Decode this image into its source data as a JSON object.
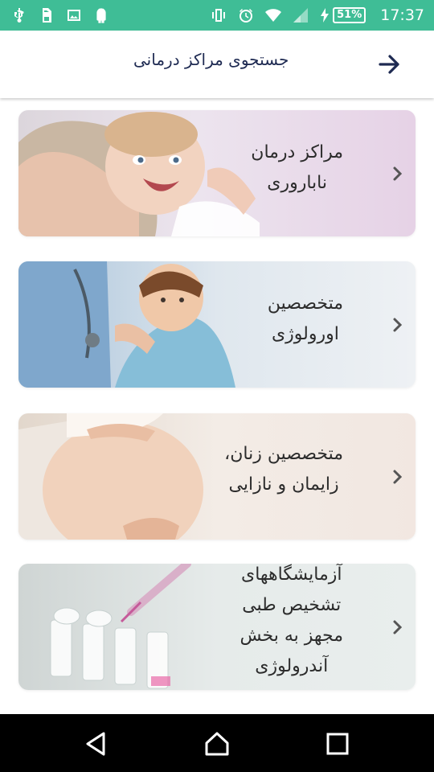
{
  "status_bar": {
    "battery_percent": "51%",
    "time": "17:37",
    "left_icons": [
      "usb-icon",
      "sim-icon",
      "image-icon",
      "android-icon"
    ],
    "right_icons": [
      "vibrate-icon",
      "alarm-icon",
      "wifi-icon",
      "signal-icon",
      "charging-icon"
    ]
  },
  "header": {
    "title": "جستجوی مراکز درمانی"
  },
  "cards": [
    {
      "line1": "مراکز درمان",
      "line2": "ناباروری",
      "line3": "",
      "line4": ""
    },
    {
      "line1": "متخصصین",
      "line2": "اورولوژی",
      "line3": "",
      "line4": ""
    },
    {
      "line1": "متخصصین زنان،",
      "line2": "زایمان و نازایی",
      "line3": "",
      "line4": ""
    },
    {
      "line1": "آزمایشگاههای",
      "line2": "تشخیص طبی",
      "line3": "مجهز به بخش",
      "line4": "آندرولوژی"
    }
  ],
  "colors": {
    "status_bar": "#3fbd96",
    "header_text": "#1e2a52",
    "card_text": "#2c2c2c",
    "nav_bar": "#000000"
  }
}
